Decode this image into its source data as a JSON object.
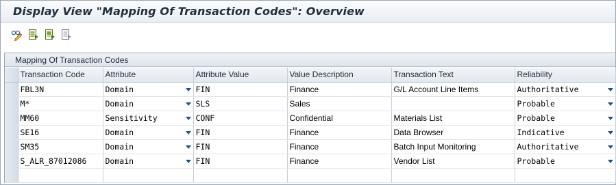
{
  "title": "Display View \"Mapping Of Transaction Codes\": Overview",
  "toolbar": {
    "buttons": [
      {
        "name": "display-change-button",
        "icon": "glasses-pencil-icon"
      },
      {
        "name": "select-all-button",
        "icon": "select-all-icon"
      },
      {
        "name": "select-block-button",
        "icon": "select-block-icon"
      },
      {
        "name": "deselect-all-button",
        "icon": "deselect-all-icon"
      }
    ]
  },
  "grid": {
    "caption": "Mapping Of Transaction Codes",
    "columns": [
      "Transaction Code",
      "Attribute",
      "Attribute Value",
      "Value Description",
      "Transaction Text",
      "Reliability"
    ],
    "rows": [
      {
        "code": "FBL3N",
        "attribute": "Domain",
        "value": "FIN",
        "description": "Finance",
        "text": "G/L Account Line Items",
        "reliability": "Authoritative"
      },
      {
        "code": "M*",
        "attribute": "Domain",
        "value": "SLS",
        "description": "Sales",
        "text": "",
        "reliability": "Probable"
      },
      {
        "code": "MM60",
        "attribute": "Sensitivity",
        "value": "CONF",
        "description": "Confidential",
        "text": "Materials List",
        "reliability": "Probable"
      },
      {
        "code": "SE16",
        "attribute": "Domain",
        "value": "FIN",
        "description": "Finance",
        "text": "Data Browser",
        "reliability": "Indicative"
      },
      {
        "code": "SM35",
        "attribute": "Domain",
        "value": "FIN",
        "description": "Finance",
        "text": "Batch Input Monitoring",
        "reliability": "Authoritative"
      },
      {
        "code": "S_ALR_87012086",
        "attribute": "Domain",
        "value": "FIN",
        "description": "Finance",
        "text": "Vendor List",
        "reliability": "Probable"
      }
    ]
  },
  "colors": {
    "dropdown_arrow": "#1f4e9c",
    "title_text": "#20303f"
  }
}
